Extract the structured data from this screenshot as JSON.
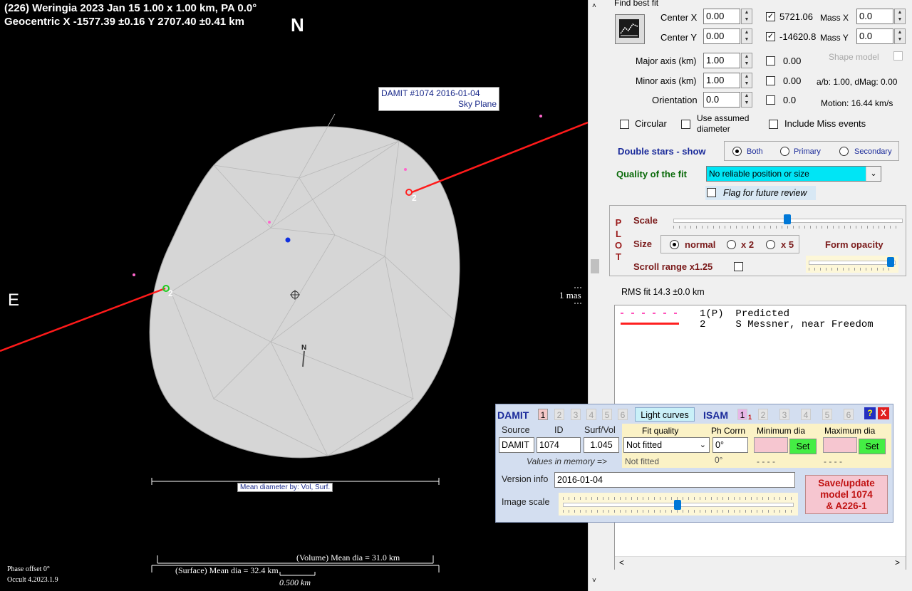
{
  "plot": {
    "header_line1": "(226) Weringia  2023 Jan 15   1.00 x 1.00 km,  PA 0.0°",
    "header_line2": "Geocentric  X  -1577.39 ±0.16  Y 2707.40 ±0.41 km",
    "north": "N",
    "east": "E",
    "model_label_line1": "DAMIT #1074 2016-01-04",
    "model_label_line2": "Sky Plane",
    "chord_label_1": "2",
    "chord_label_2": "2",
    "pole_label": "N",
    "scale_marker": "1 mas",
    "mean_dia_label": "Mean diameter by: Vol, Surf.",
    "volume_dia": "(Volume) Mean dia = 31.0 km",
    "surface_dia": "(Surface) Mean dia = 32.4 km",
    "scale_km": "0.500 km",
    "phase_offset": "Phase offset 0°",
    "version": "Occult 4.2023.1.9"
  },
  "fit": {
    "find_best_fit": "Find best fit",
    "center_x_label": "Center X",
    "center_x": "0.00",
    "center_y_label": "Center Y",
    "center_y": "0.00",
    "cx_value": "5721.06",
    "cy_value": "-14620.8",
    "mass_x_label": "Mass X",
    "mass_x": "0.0",
    "mass_y_label": "Mass Y",
    "mass_y": "0.0",
    "major_label": "Major axis (km)",
    "major": "1.00",
    "major_val": "0.00",
    "minor_label": "Minor axis (km)",
    "minor": "1.00",
    "minor_val": "0.00",
    "orient_label": "Orientation",
    "orient": "0.0",
    "orient_val": "0.0",
    "shape_model": "Shape model",
    "ab_dmag": "a/b: 1.00, dMag: 0.00",
    "motion": "Motion: 16.44 km/s",
    "circular": "Circular",
    "use_assumed_1": "Use assumed",
    "use_assumed_2": "diameter",
    "include_miss": "Include Miss events",
    "double_stars": "Double stars - show",
    "both": "Both",
    "primary": "Primary",
    "secondary": "Secondary",
    "quality_label": "Quality of the fit",
    "quality_value": "No reliable position or size",
    "flag_review": "Flag for future review"
  },
  "plotpanel": {
    "p": "P",
    "l": "L",
    "o": "O",
    "t": "T",
    "scale": "Scale",
    "size": "Size",
    "normal": "normal",
    "x2": "x 2",
    "x5": "x 5",
    "form_opacity": "Form opacity",
    "scroll_range": "Scroll range x1.25",
    "scale_level": 0.5,
    "opacity_level": 0.98
  },
  "rms": "RMS fit 14.3 ±0.0 km",
  "legend": [
    {
      "num": "1(P)",
      "text": "Predicted"
    },
    {
      "num": "2",
      "text": "S Messner, near Freedom"
    }
  ],
  "damit": {
    "title": "DAMIT",
    "nums": [
      "1",
      "2",
      "3",
      "4",
      "5",
      "6"
    ],
    "light_curves": "Light curves",
    "isam": "ISAM",
    "isam_sub": "1",
    "help": "?",
    "close": "X",
    "source_h": "Source",
    "id_h": "ID",
    "surfvol_h": "Surf/Vol",
    "fitq_h": "Fit quality",
    "phcorr_h": "Ph Corrn",
    "mindia_h": "Minimum dia",
    "maxdia_h": "Maximum dia",
    "source": "DAMIT",
    "id": "1074",
    "surfvol": "1.045",
    "fitq": "Not fitted",
    "phcorr": "0°",
    "set": "Set",
    "values_mem": "Values in memory =>",
    "fitq_mem": "Not fitted",
    "phcorr_mem": "0°",
    "min_mem": "- - - -",
    "max_mem": "- - - -",
    "version_label": "Version info",
    "version": "2016-01-04",
    "image_scale": "Image scale",
    "image_scale_level": 0.5,
    "save_1": "Save/update",
    "save_2": "model 1074",
    "save_3": "& A226-1"
  }
}
